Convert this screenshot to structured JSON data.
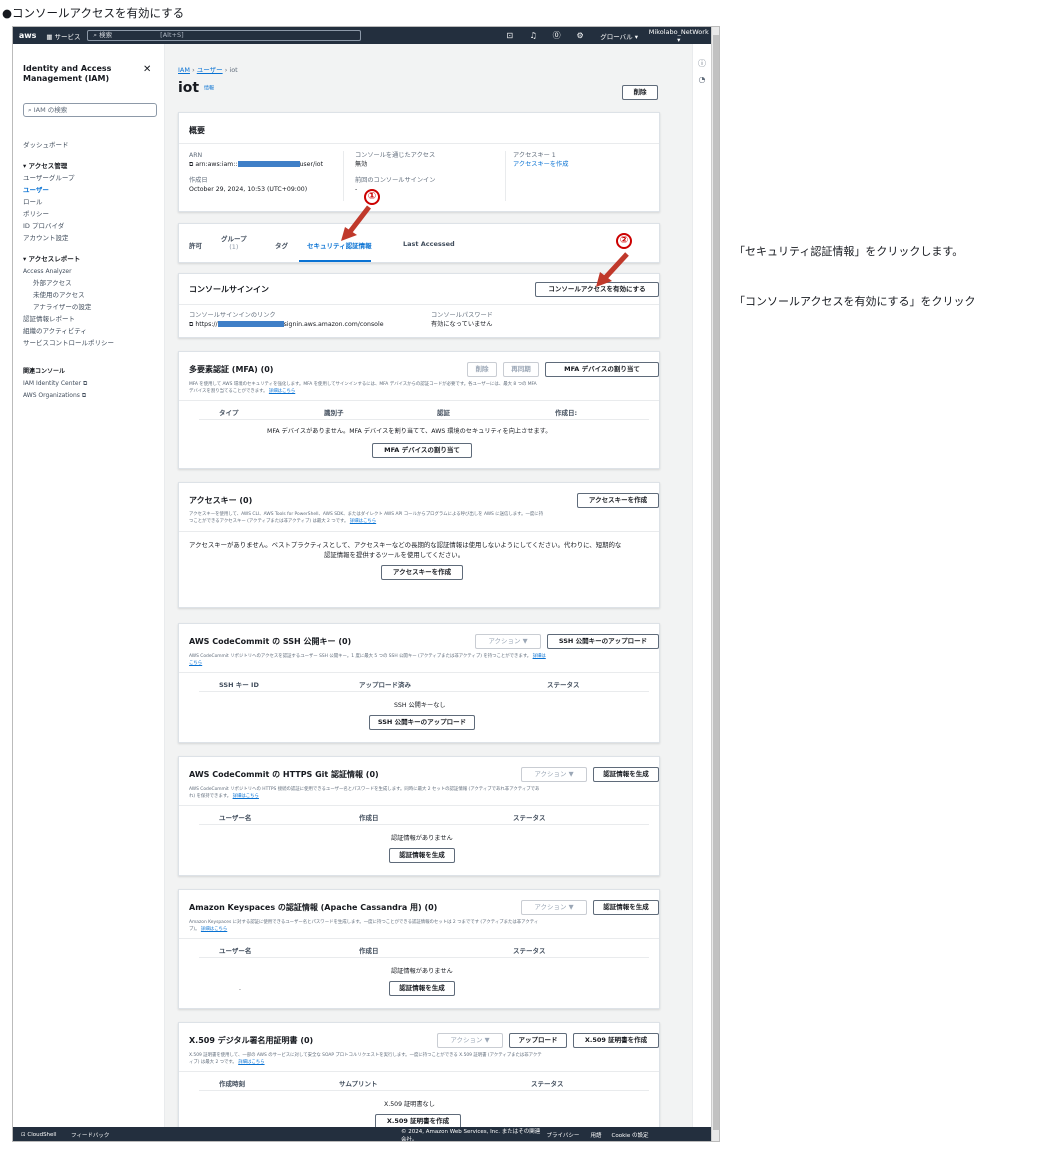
{
  "caption": "●コンソールアクセスを有効にする",
  "notes": [
    "「セキュリティ認証情報」をクリックします。",
    "「コンソールアクセスを有効にする」をクリック"
  ],
  "topnav": {
    "logo": "aws",
    "services": "サービス",
    "search": "検索",
    "shortcut": "[Alt+S]",
    "region": "グローバル ▾",
    "account": "Mikolabo_NetWork ▾"
  },
  "sidebar": {
    "title": "Identity and Access Management (IAM)",
    "search_placeholder": "IAM の検索",
    "items": [
      "ダッシュボード",
      "アクセス管理",
      "ユーザーグループ",
      "ユーザー",
      "ロール",
      "ポリシー",
      "ID プロバイダ",
      "アカウント設定",
      "アクセスレポート",
      "Access Analyzer",
      "外部アクセス",
      "未使用のアクセス",
      "アナライザーの設定",
      "認証情報レポート",
      "組織のアクティビティ",
      "サービスコントロールポリシー",
      "関連コンソール",
      "IAM Identity Center",
      "AWS Organizations"
    ]
  },
  "breadcrumb": {
    "iam": "IAM",
    "users": "ユーザー",
    "current": "iot"
  },
  "page": {
    "title": "iot",
    "info": "情報",
    "delete": "削除"
  },
  "summary": {
    "title": "概要",
    "arn_label": "ARN",
    "arn_value": "arn:aws:iam::",
    "arn_suffix": "user/iot",
    "created_label": "作成日",
    "created_value": "October 29, 2024, 10:53 (UTC+09:00)",
    "console_label": "コンソールを通じたアクセス",
    "console_value": "無効",
    "last_signin_label": "前回のコンソールサインイン",
    "last_signin_value": "-",
    "key_label": "アクセスキー 1",
    "key_link": "アクセスキーを作成"
  },
  "tabs": [
    "許可",
    "グループ",
    "(1)",
    "タグ",
    "セキュリティ認証情報",
    "Last Accessed"
  ],
  "console": {
    "title": "コンソールサインイン",
    "button": "コンソールアクセスを有効にする",
    "link_label": "コンソールサインインのリンク",
    "link_value_a": "https://",
    "link_value_b": "signin.aws.amazon.com/console",
    "pw_label": "コンソールパスワード",
    "pw_value": "有効になっていません"
  },
  "mfa": {
    "title": "多要素認証 (MFA) (0)",
    "desc": "MFA を使用して AWS 環境のセキュリティを強化します。MFA を使用してサインインするには、MFA デバイスからの認証コードが必要です。各ユーザーには、最大 8 つの MFA",
    "desc2": "デバイスを割り当てることができます。",
    "more": "詳細はこちら",
    "b_delete": "削除",
    "b_resync": "再同期",
    "b_assign": "MFA デバイスの割り当て",
    "cols": [
      "タイプ",
      "識別子",
      "認証",
      "作成日:"
    ],
    "empty": "MFA デバイスがありません。MFA デバイスを割り当てて、AWS 環境のセキュリティを向上させます。",
    "empty_btn": "MFA デバイスの割り当て"
  },
  "keys": {
    "title": "アクセスキー (0)",
    "btn": "アクセスキーを作成",
    "desc": "アクセスキーを使用して、AWS CLI、AWS Tools for PowerShell、AWS SDK、またはダイレクト AWS API コールからプログラムによる呼び出しを AWS に送信します。一度に持",
    "desc2": "つことができるアクセスキー (アクティブまたは非アクティブ) は最大 2 つです。",
    "more": "詳細はこちら",
    "empty1": "アクセスキーがありません。ベストプラクティスとして、アクセスキーなどの長期的な認証情報は使用しないようにしてください。代わりに、短期的な",
    "empty2": "認証情報を提供するツールを使用してください。",
    "empty_btn": "アクセスキーを作成"
  },
  "ssh": {
    "title": "AWS CodeCommit の SSH 公開キー (0)",
    "actions": "アクション ▼",
    "upload": "SSH 公開キーのアップロード",
    "desc": "AWS CodeCommit リポジトリへのアクセスを認証するユーザー SSH 公開キー。1 度に最大 5 つの SSH 公開キー (アクティブまたは非アクティブ) を持つことができます。",
    "more": "詳細は",
    "more2": "こちら",
    "cols": [
      "SSH キー ID",
      "アップロード済み",
      "ステータス"
    ],
    "empty": "SSH 公開キーなし",
    "empty_btn": "SSH 公開キーのアップロード"
  },
  "https": {
    "title": "AWS CodeCommit の HTTPS Git 認証情報 (0)",
    "actions": "アクション ▼",
    "gen": "認証情報を生成",
    "desc": "AWS CodeCommit リポジトリへの HTTPS 接続の認証に使用できるユーザー名とパスワードを生成します。同時に最大 2 セットの認証情報 (アクティブであれ非アクティブであ",
    "desc2": "れ) を保持できます。",
    "more": "詳細はこちら",
    "cols": [
      "ユーザー名",
      "作成日",
      "ステータス"
    ],
    "empty": "認証情報がありません",
    "empty_btn": "認証情報を生成"
  },
  "keyspaces": {
    "title": "Amazon Keyspaces の認証情報 (Apache Cassandra 用) (0)",
    "actions": "アクション ▼",
    "gen": "認証情報を生成",
    "desc": "Amazon Keyspaces に対する認証に使用できるユーザー名とパスワードを生成します。一度に持つことができる認証情報のセットは 2 つまでです (アクティブまたは非アクティ",
    "desc2": "ブ)。",
    "more": "詳細はこちら",
    "cols": [
      "ユーザー名",
      "作成日",
      "ステータス"
    ],
    "empty": "認証情報がありません",
    "empty_btn": "認証情報を生成",
    "dot": "."
  },
  "x509": {
    "title": "X.509 デジタル署名用証明書 (0)",
    "actions": "アクション ▼",
    "upload": "アップロード",
    "create": "X.509 証明書を作成",
    "desc": "X.509 証明書を使用して、一部の AWS のサービスに対して安全な SOAP プロトコルリクエストを実行します。一度に持つことができる X.509 証明書 (アクティブまたは非アクテ",
    "desc2": "ィブ) は最大 2 つです。",
    "more": "詳細はこちら",
    "cols": [
      "作成時刻",
      "サムプリント",
      "ステータス"
    ],
    "empty": "X.509 証明書なし",
    "empty_btn": "X.509 証明書を作成"
  },
  "footer": {
    "cloudshell": "CloudShell",
    "feedback": "フィードバック",
    "copyright": "© 2024, Amazon Web Services, Inc. またはその関連会社。",
    "privacy": "プライバシー",
    "terms": "用語",
    "cookie": "Cookie の設定"
  },
  "markers": [
    "①",
    "②"
  ]
}
